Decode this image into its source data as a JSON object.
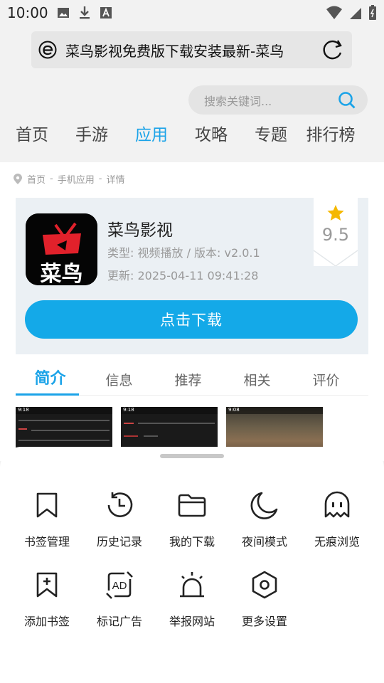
{
  "status_bar": {
    "time": "10:00"
  },
  "browser": {
    "url_title": "菜鸟影视免费版下载安装最新-菜鸟"
  },
  "site": {
    "search_placeholder": "搜索关键词...",
    "nav": [
      {
        "label": "首页"
      },
      {
        "label": "手游"
      },
      {
        "label": "应用",
        "active": true
      },
      {
        "label": "攻略"
      },
      {
        "label": "专题"
      },
      {
        "label": "排行榜"
      }
    ]
  },
  "breadcrumb": {
    "home": "首页",
    "sep1": "-",
    "category": "手机应用",
    "sep2": "-",
    "current": "详情"
  },
  "app": {
    "icon_text": "菜鸟",
    "name": "菜鸟影视",
    "type_version": "类型: 视频播放 / 版本: v2.0.1",
    "update": "更新:  2025-04-11 09:41:28",
    "rating": "9.5",
    "download_label": "点击下载"
  },
  "tabs": [
    {
      "label": "简介",
      "active": true
    },
    {
      "label": "信息"
    },
    {
      "label": "推荐"
    },
    {
      "label": "相关"
    },
    {
      "label": "评价"
    }
  ],
  "screenshots": [
    {
      "time": "9:18"
    },
    {
      "time": "9:18"
    },
    {
      "time": "9:08"
    }
  ],
  "menu": [
    {
      "label": "书签管理",
      "icon": "bookmark-icon"
    },
    {
      "label": "历史记录",
      "icon": "history-icon"
    },
    {
      "label": "我的下载",
      "icon": "folder-icon"
    },
    {
      "label": "夜间模式",
      "icon": "moon-icon"
    },
    {
      "label": "无痕浏览",
      "icon": "ghost-icon"
    },
    {
      "label": "添加书签",
      "icon": "add-bookmark-icon"
    },
    {
      "label": "标记广告",
      "icon": "ad-mark-icon"
    },
    {
      "label": "举报网站",
      "icon": "alarm-icon"
    },
    {
      "label": "更多设置",
      "icon": "settings-icon"
    }
  ],
  "colors": {
    "accent": "#1ba3e8",
    "button": "#14a9e8",
    "star": "#f5b800"
  }
}
